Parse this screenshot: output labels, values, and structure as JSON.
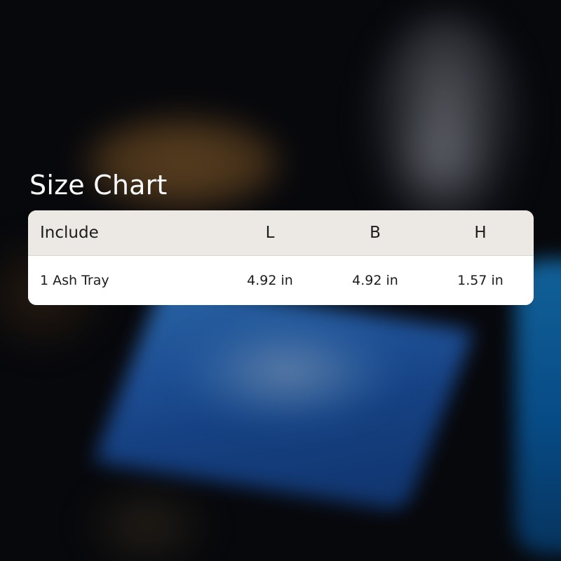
{
  "title": "Size Chart",
  "table": {
    "headers": [
      "Include",
      "L",
      "B",
      "H"
    ],
    "rows": [
      [
        "1 Ash Tray",
        "4.92 in",
        "4.92 in",
        "1.57 in"
      ]
    ]
  }
}
